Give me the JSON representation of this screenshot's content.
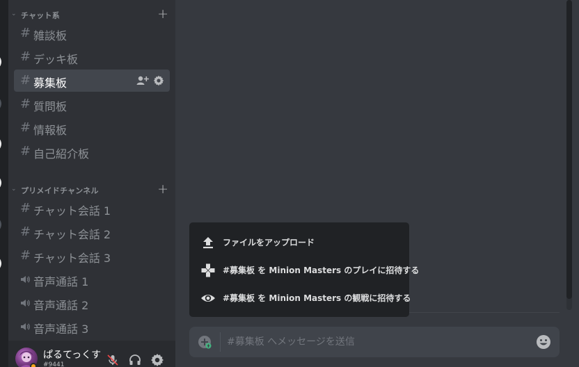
{
  "categories": [
    {
      "label": "チャット系"
    },
    {
      "label": "プリメイドチャンネル"
    }
  ],
  "text_channels": [
    {
      "name": "雑談板"
    },
    {
      "name": "デッキ板"
    },
    {
      "name": "募集板"
    },
    {
      "name": "質問板"
    },
    {
      "name": "情報板"
    },
    {
      "name": "自己紹介板"
    }
  ],
  "premade_channels": [
    {
      "name": "チャット会話 1"
    },
    {
      "name": "チャット会話 2"
    },
    {
      "name": "チャット会話 3"
    }
  ],
  "voice_channels": [
    {
      "name": "音声通話 1"
    },
    {
      "name": "音声通話 2"
    },
    {
      "name": "音声通話 3"
    }
  ],
  "hash_symbol": "#",
  "plus_symbol": "+",
  "chevron_symbol": "⌄",
  "user": {
    "name": "ぱるてっくす",
    "tag": "#9441"
  },
  "popup": {
    "items": [
      {
        "label": "ファイルをアップロード",
        "icon": "upload-icon"
      },
      {
        "label": "#募集板 を Minion Masters のプレイに招待する",
        "icon": "gamepad-icon"
      },
      {
        "label": "#募集板 を Minion Masters の観戦に招待する",
        "icon": "eye-icon"
      }
    ]
  },
  "composer": {
    "placeholder": "#募集板 へメッセージを送信"
  },
  "colors": {
    "accent_green": "#43b581",
    "status_idle": "#faa61a"
  }
}
